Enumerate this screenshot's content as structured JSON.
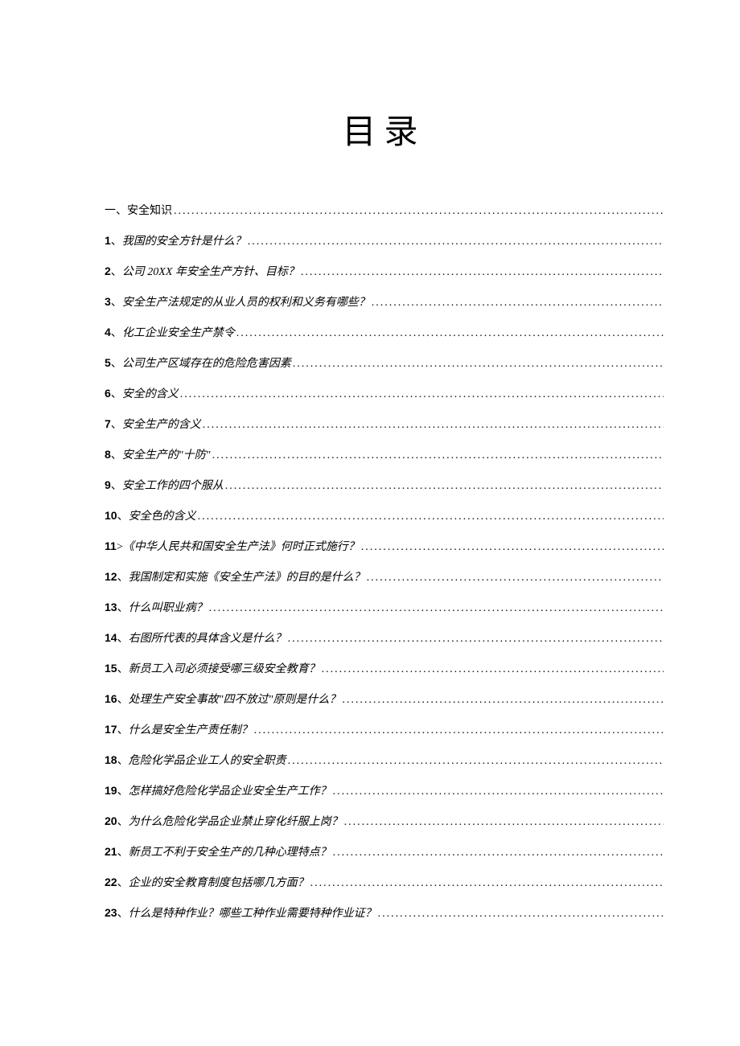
{
  "title": "目录",
  "section": {
    "num": "一、",
    "label": "安全知识"
  },
  "items": [
    {
      "num": "1",
      "sep": "、",
      "label": "我国的安全方针是什么？"
    },
    {
      "num": "2",
      "sep": "、",
      "label": "公司 20XX 年安全生产方针、目标？"
    },
    {
      "num": "3",
      "sep": "、",
      "label": "安全生产法规定的从业人员的权利和义务有哪些？"
    },
    {
      "num": "4",
      "sep": "、",
      "label": "化工企业安全生产禁令"
    },
    {
      "num": "5",
      "sep": "、",
      "label": "公司生产区域存在的危险危害因素"
    },
    {
      "num": "6",
      "sep": "、",
      "label": "安全的含义"
    },
    {
      "num": "7",
      "sep": "、",
      "label": "安全生产的含义"
    },
    {
      "num": "8",
      "sep": "、",
      "label": "安全生产的\"十防\""
    },
    {
      "num": "9",
      "sep": "、",
      "label": "安全工作的四个服从"
    },
    {
      "num": "10",
      "sep": "、",
      "label": "安全色的含义"
    },
    {
      "num": "11",
      "sep": ">",
      "label": "《中华人民共和国安全生产法》何时正式施行？"
    },
    {
      "num": "12",
      "sep": "、",
      "label": "我国制定和实施《安全生产法》的目的是什么？"
    },
    {
      "num": "13",
      "sep": "、",
      "label": "什么叫职业病？"
    },
    {
      "num": "14",
      "sep": "、",
      "label": "右图所代表的具体含义是什么？"
    },
    {
      "num": "15",
      "sep": "、",
      "label": "新员工入司必须接受哪三级安全教育？"
    },
    {
      "num": "16",
      "sep": "、",
      "label": "处理生产安全事故\"四不放过\"原则是什么？"
    },
    {
      "num": "17",
      "sep": "、",
      "label": "什么是安全生产责任制？"
    },
    {
      "num": "18",
      "sep": "、",
      "label": "危险化学品企业工人的安全职责"
    },
    {
      "num": "19",
      "sep": "、",
      "label": "怎样搞好危险化学品企业安全生产工作？"
    },
    {
      "num": "20",
      "sep": "、",
      "label": "为什么危险化学品企业禁止穿化纤服上岗？"
    },
    {
      "num": "21",
      "sep": "、",
      "label": "新员工不利于安全生产的几种心理特点？"
    },
    {
      "num": "22",
      "sep": "、",
      "label": "企业的安全教育制度包括哪几方面？"
    },
    {
      "num": "23",
      "sep": "、",
      "label": "什么是特种作业？哪些工种作业需要特种作业证？"
    }
  ]
}
